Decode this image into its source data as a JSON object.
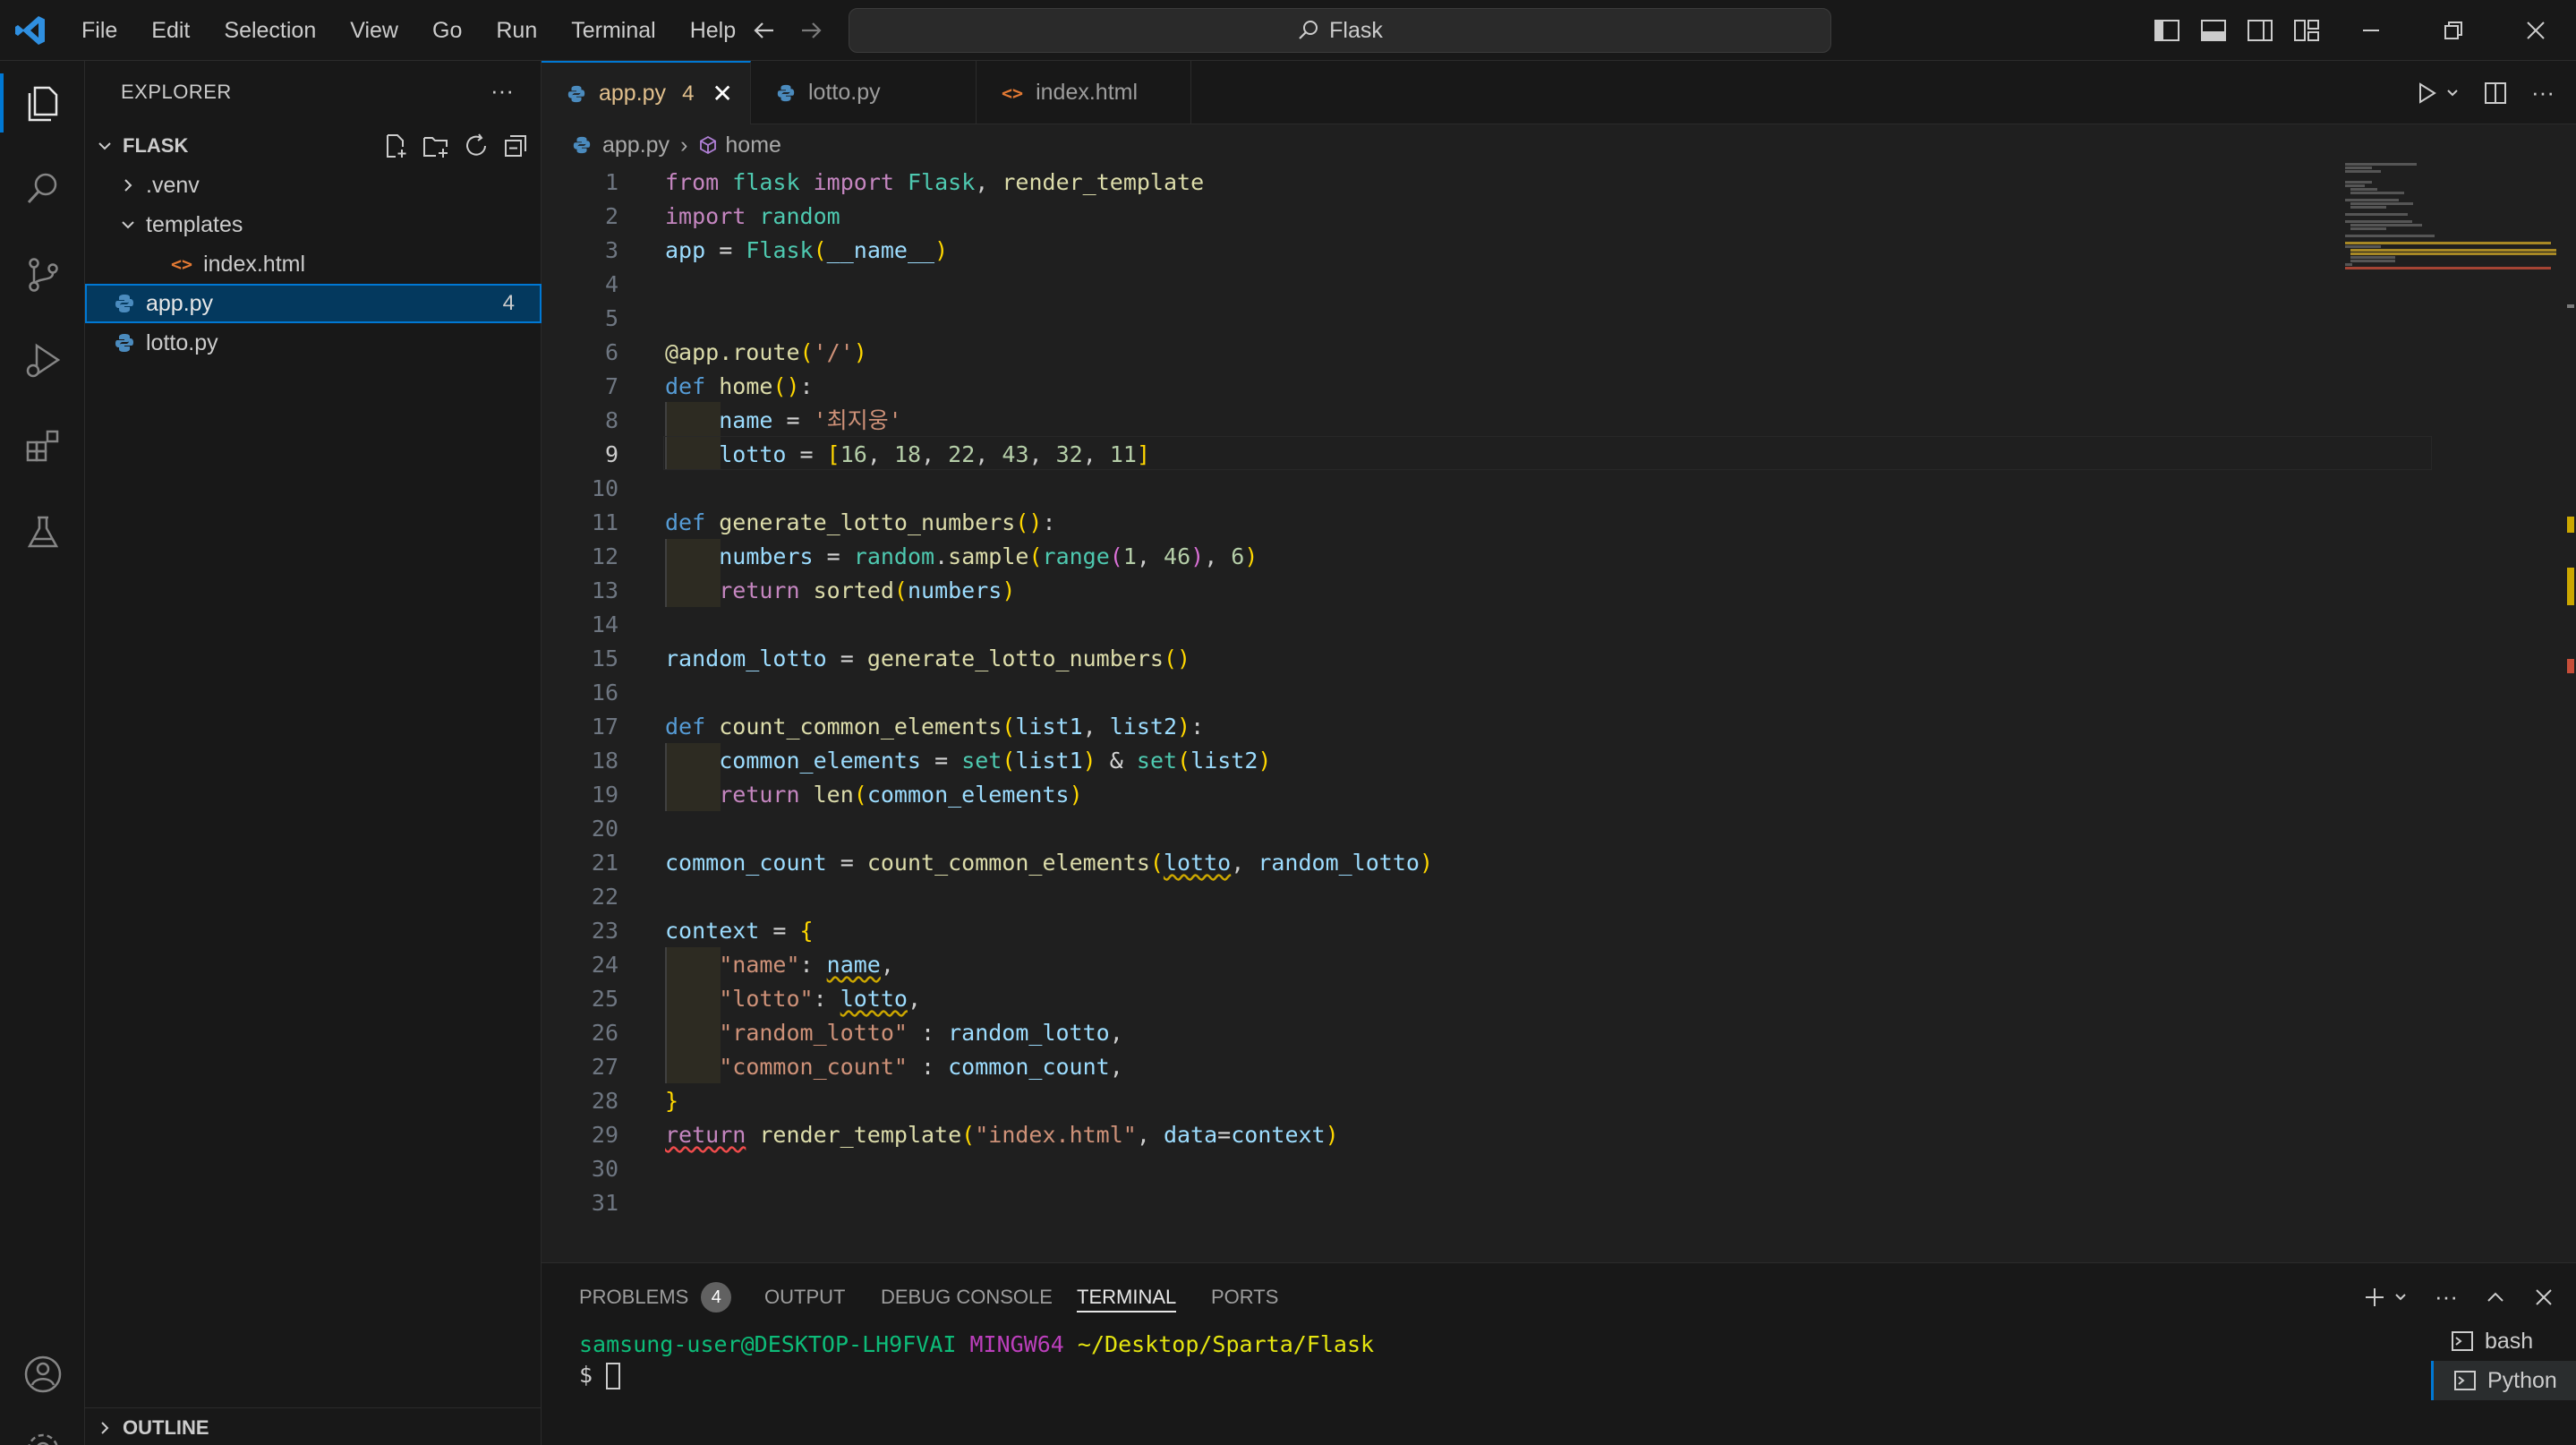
{
  "titlebar": {
    "menus": [
      "File",
      "Edit",
      "Selection",
      "View",
      "Go",
      "Run",
      "Terminal",
      "Help"
    ],
    "search_text": "Flask"
  },
  "sidebar": {
    "title": "EXPLORER",
    "root_folder": "FLASK",
    "items": [
      {
        "label": ".venv",
        "type": "folder-collapsed"
      },
      {
        "label": "templates",
        "type": "folder-expanded"
      },
      {
        "label": "index.html",
        "type": "html"
      },
      {
        "label": "app.py",
        "type": "python",
        "problems": "4"
      },
      {
        "label": "lotto.py",
        "type": "python"
      }
    ],
    "outline_label": "OUTLINE"
  },
  "tabs": [
    {
      "label": "app.py",
      "problems": "4",
      "active": true
    },
    {
      "label": "lotto.py"
    },
    {
      "label": "index.html"
    }
  ],
  "breadcrumb": {
    "file": "app.py",
    "symbol": "home"
  },
  "editor": {
    "current_line": 9,
    "line_numbers": [
      "1",
      "2",
      "3",
      "4",
      "5",
      "6",
      "7",
      "8",
      "9",
      "10",
      "11",
      "12",
      "13",
      "14",
      "15",
      "16",
      "17",
      "18",
      "19",
      "20",
      "21",
      "22",
      "23",
      "24",
      "25",
      "26",
      "27",
      "28",
      "29",
      "30",
      "31"
    ]
  },
  "panel": {
    "tabs": [
      "PROBLEMS",
      "OUTPUT",
      "DEBUG CONSOLE",
      "TERMINAL",
      "PORTS"
    ],
    "problems_count": "4",
    "active_tab": "TERMINAL",
    "terminal": {
      "user": "samsung-user@DESKTOP-LH9FVAI",
      "env": "MINGW64",
      "path": "~/Desktop/Sparta/Flask",
      "prompt": "$"
    },
    "terminals": [
      "bash",
      "Python"
    ]
  }
}
